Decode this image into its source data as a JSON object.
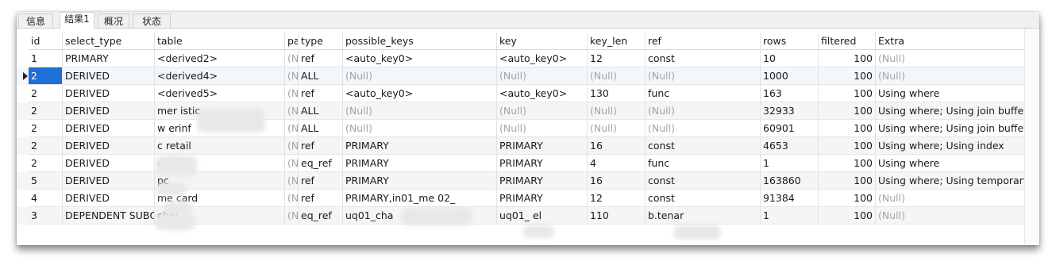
{
  "tabs": [
    "信息",
    "结果1",
    "概况",
    "状态"
  ],
  "columns": [
    "id",
    "select_type",
    "table",
    "pa",
    "type",
    "possible_keys",
    "key",
    "key_len",
    "ref",
    "rows",
    "filtered",
    "Extra"
  ],
  "rows": [
    [
      "1",
      "PRIMARY",
      "<derived2>",
      "(N",
      "ref",
      "<auto_key0>",
      "<auto_key0>",
      "12",
      "const",
      "10",
      "100",
      "(Null)"
    ],
    [
      "2",
      "DERIVED",
      "<derived4>",
      "(N",
      "ALL",
      "(Null)",
      "(Null)",
      "(Null)",
      "(Null)",
      "1000",
      "100",
      "(Null)"
    ],
    [
      "2",
      "DERIVED",
      "<derived5>",
      "(N",
      "ref",
      "<auto_key0>",
      "<auto_key0>",
      "130",
      "func",
      "163",
      "100",
      "Using where"
    ],
    [
      "2",
      "DERIVED",
      "mer          istic",
      "(N",
      "ALL",
      "(Null)",
      "(Null)",
      "(Null)",
      "(Null)",
      "32933",
      "100",
      "Using where; Using join buffer ("
    ],
    [
      "2",
      "DERIVED",
      "w      erinf",
      "(N",
      "ALL",
      "(Null)",
      "(Null)",
      "(Null)",
      "(Null)",
      "60901",
      "100",
      "Using where; Using join buffer ("
    ],
    [
      "2",
      "DERIVED",
      "c         retail",
      "(N",
      "ref",
      "PRIMARY",
      "PRIMARY",
      "16",
      "const",
      "4653",
      "100",
      "Using where; Using index"
    ],
    [
      "2",
      "DERIVED",
      "c      erlist",
      "(N",
      "eq_ref",
      "PRIMARY",
      "PRIMARY",
      "4",
      "func",
      "1",
      "100",
      "Using where"
    ],
    [
      "5",
      "DERIVED",
      "pc",
      "(N",
      "ref",
      "PRIMARY",
      "PRIMARY",
      "16",
      "const",
      "163860",
      "100",
      "Using where; Using temporary;"
    ],
    [
      "4",
      "DERIVED",
      "me        card",
      "(N",
      "ref",
      "PRIMARY,in01_me              02_",
      "PRIMARY",
      "12",
      "const",
      "91384",
      "100",
      "(Null)"
    ],
    [
      "3",
      "DEPENDENT SUBQU",
      "char",
      "(N",
      "eq_ref",
      "uq01_cha",
      "uq01_         el",
      "110",
      "b.tenar",
      "1",
      "100",
      "(Null)"
    ]
  ]
}
